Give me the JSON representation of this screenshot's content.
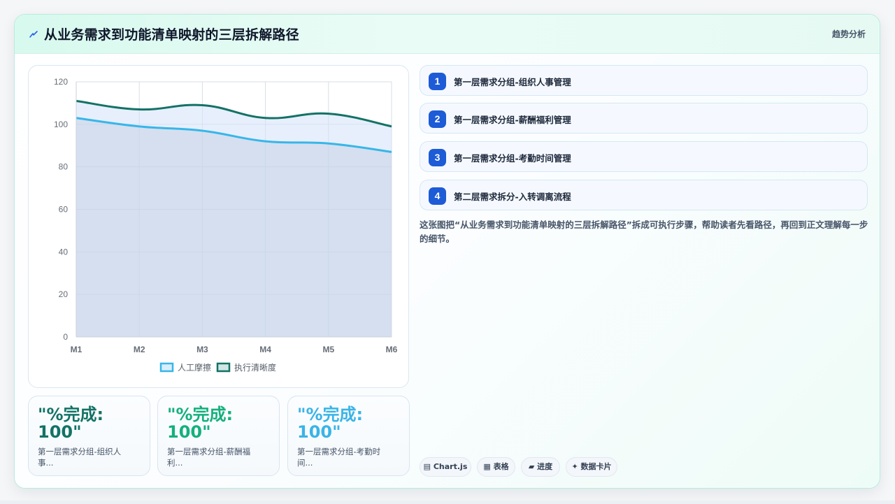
{
  "header": {
    "icon": "lightning-icon",
    "title": "从业务需求到功能清单映射的三层拆解路径",
    "tag": "趋势分析"
  },
  "chart_data": {
    "type": "area",
    "categories": [
      "M1",
      "M2",
      "M3",
      "M4",
      "M5",
      "M6"
    ],
    "series": [
      {
        "name": "人工摩擦",
        "values": [
          103,
          99,
          97,
          92,
          91,
          87
        ],
        "color": "#38b6e8"
      },
      {
        "name": "执行清晰度",
        "values": [
          111,
          107,
          109,
          103,
          105,
          99
        ],
        "color": "#137266"
      }
    ],
    "y_ticks": [
      0,
      20,
      40,
      60,
      80,
      100,
      120
    ],
    "ylim": [
      0,
      120
    ],
    "grid": true,
    "legend": "bottom"
  },
  "stats": [
    {
      "value": "\"%完成: 100\"",
      "label": "第一层需求分组-组织人事...",
      "color": "#137266"
    },
    {
      "value": "\"%完成: 100\"",
      "label": "第一层需求分组-薪酬福利...",
      "color": "#14b07c"
    },
    {
      "value": "\"%完成: 100\"",
      "label": "第一层需求分组-考勤时间...",
      "color": "#3ab4e6"
    }
  ],
  "steps": [
    {
      "num": "1",
      "text": "第一层需求分组-组织人事管理"
    },
    {
      "num": "2",
      "text": "第一层需求分组-薪酬福利管理"
    },
    {
      "num": "3",
      "text": "第一层需求分组-考勤时间管理"
    },
    {
      "num": "4",
      "text": "第二层需求拆分-入转调离流程"
    }
  ],
  "description": "这张图把“从业务需求到功能清单映射的三层拆解路径”拆成可执行步骤，帮助读者先看路径，再回到正文理解每一步的细节。",
  "tags": [
    {
      "icon": "▤",
      "label": "Chart.js"
    },
    {
      "icon": "▦",
      "label": "表格"
    },
    {
      "icon": "▰",
      "label": "进度"
    },
    {
      "icon": "✦",
      "label": "数据卡片"
    }
  ]
}
